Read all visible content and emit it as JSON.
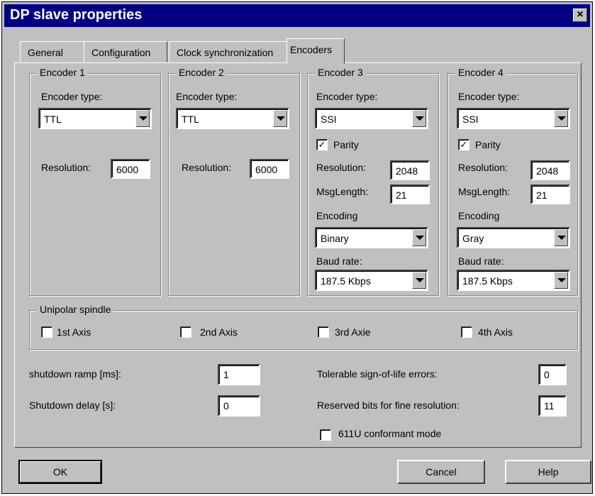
{
  "window": {
    "title": "DP slave properties",
    "close_glyph": "×"
  },
  "tabs": [
    {
      "label": "General"
    },
    {
      "label": "Configuration"
    },
    {
      "label": "Clock synchronization"
    },
    {
      "label": "Encoders",
      "active": true
    }
  ],
  "encoders": [
    {
      "title": "Encoder 1",
      "type_label": "Encoder type:",
      "type": "TTL",
      "resolution_label": "Resolution:",
      "resolution": "6000"
    },
    {
      "title": "Encoder 2",
      "type_label": "Encoder type:",
      "type": "TTL",
      "resolution_label": "Resolution:",
      "resolution": "6000"
    },
    {
      "title": "Encoder 3",
      "type_label": "Encoder type:",
      "type": "SSI",
      "parity_label": "Parity",
      "parity_checked": true,
      "resolution_label": "Resolution:",
      "resolution": "2048",
      "msglength_label": "MsgLength:",
      "msglength": "21",
      "encoding_label": "Encoding",
      "encoding": "Binary",
      "baud_label": "Baud rate:",
      "baud": "187.5 Kbps"
    },
    {
      "title": "Encoder 4",
      "type_label": "Encoder type:",
      "type": "SSI",
      "parity_label": "Parity",
      "parity_checked": true,
      "resolution_label": "Resolution:",
      "resolution": "2048",
      "msglength_label": "MsgLength:",
      "msglength": "21",
      "encoding_label": "Encoding",
      "encoding": "Gray",
      "baud_label": "Baud rate:",
      "baud": "187.5 Kbps"
    }
  ],
  "unipolar": {
    "title": "Unipolar spindle",
    "axes": [
      {
        "label": "1st Axis",
        "checked": false
      },
      {
        "label": "2nd Axis",
        "checked": false
      },
      {
        "label": "3rd Axie",
        "checked": false
      },
      {
        "label": "4th Axis",
        "checked": false
      }
    ]
  },
  "settings": {
    "shutdown_ramp_label": "shutdown ramp [ms]:",
    "shutdown_ramp": "1",
    "shutdown_delay_label": "Shutdown delay [s]:",
    "shutdown_delay": "0",
    "sign_of_life_label": "Tolerable sign-of-life errors:",
    "sign_of_life": "0",
    "reserved_bits_label": "Reserved bits for fine resolution:",
    "reserved_bits": "11",
    "conformant_label": "611U conformant mode",
    "conformant_checked": false
  },
  "buttons": {
    "ok": "OK",
    "cancel": "Cancel",
    "help": "Help"
  }
}
